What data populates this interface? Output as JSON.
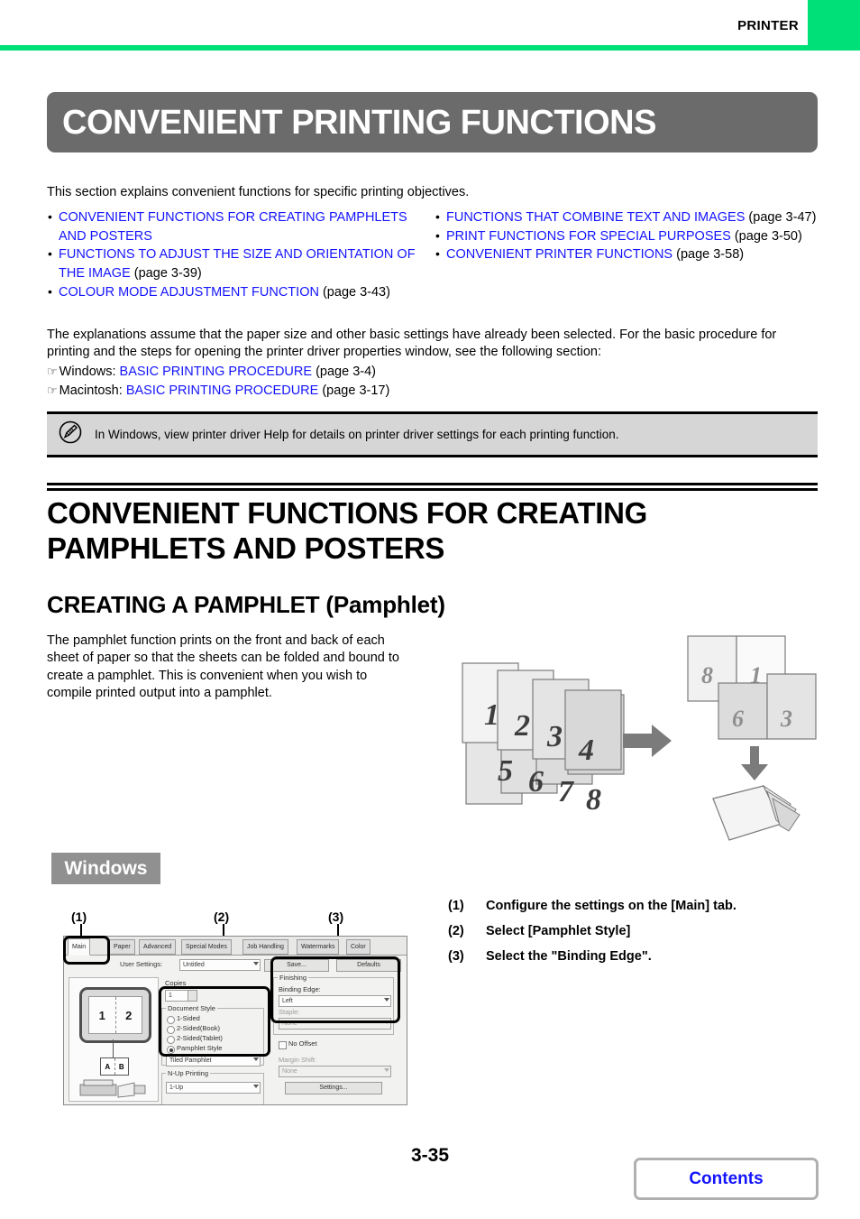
{
  "header": {
    "section_label": "PRINTER",
    "accent_color": "#00e078"
  },
  "page_title": "CONVENIENT PRINTING FUNCTIONS",
  "intro": "This section explains convenient functions for specific printing objectives.",
  "links": {
    "left": [
      {
        "text": "CONVENIENT FUNCTIONS FOR CREATING PAMPHLETS AND POSTERS",
        "page": ""
      },
      {
        "text": "FUNCTIONS TO ADJUST THE SIZE AND ORIENTATION OF THE IMAGE",
        "page": " (page 3-39)"
      },
      {
        "text": "COLOUR MODE ADJUSTMENT FUNCTION",
        "page": " (page 3-43)"
      }
    ],
    "right": [
      {
        "text": "FUNCTIONS THAT COMBINE TEXT AND IMAGES",
        "page": " (page 3-47)"
      },
      {
        "text": "PRINT FUNCTIONS FOR SPECIAL PURPOSES",
        "page": " (page 3-50)"
      },
      {
        "text": "CONVENIENT PRINTER FUNCTIONS",
        "page": " (page 3-58)"
      }
    ]
  },
  "explanation": "The explanations assume that the paper size and other basic settings have already been selected. For the basic procedure for printing and the steps for opening the printer driver properties window, see the following section:",
  "procedures": [
    {
      "os": "Windows: ",
      "link": "BASIC PRINTING PROCEDURE",
      "page": " (page 3-4)"
    },
    {
      "os": "Macintosh: ",
      "link": "BASIC PRINTING PROCEDURE",
      "page": " (page 3-17)"
    }
  ],
  "note": {
    "icon": "pencil-note-icon",
    "text": "In Windows, view printer driver Help for details on printer driver settings for each printing function."
  },
  "section_heading": "CONVENIENT FUNCTIONS FOR CREATING PAMPHLETS AND POSTERS",
  "sub_heading": "CREATING A PAMPHLET (Pamphlet)",
  "pamphlet_description": "The pamphlet function prints on the front and back of each sheet of paper so that the sheets can be folded and bound to create a pamphlet. This is convenient when you wish to compile printed output into a pamphlet.",
  "illustration": {
    "source_pages": [
      "1",
      "2",
      "3",
      "4",
      "5",
      "6",
      "7",
      "8"
    ],
    "result_sheet_front": [
      "8",
      "1"
    ],
    "result_sheet_back": [
      "6",
      "3"
    ],
    "arrow_right": "right-arrow-icon",
    "arrow_down": "down-arrow-icon"
  },
  "platform_badge": "Windows",
  "callouts": [
    "(1)",
    "(2)",
    "(3)"
  ],
  "instructions": [
    {
      "num": "(1)",
      "text": "Configure the settings on the [Main] tab."
    },
    {
      "num": "(2)",
      "text": "Select [Pamphlet Style]"
    },
    {
      "num": "(3)",
      "text": "Select the \"Binding Edge\"."
    }
  ],
  "dialog": {
    "tabs": [
      "Main",
      "Paper",
      "Advanced",
      "Special Modes",
      "Job Handling",
      "Watermarks",
      "Color"
    ],
    "active_tab": "Main",
    "user_settings_label": "User Settings:",
    "user_settings_value": "Untitled",
    "save_button": "Save...",
    "defaults_button": "Defaults",
    "copies_label": "Copies",
    "copies_value": "1",
    "preview_pages": [
      "1",
      "2"
    ],
    "preview_ab": [
      "A",
      "B"
    ],
    "document_style": {
      "title": "Document Style",
      "options": [
        "1-Sided",
        "2-Sided(Book)",
        "2-Sided(Tablet)",
        "Pamphlet Style"
      ],
      "selected": "Pamphlet Style",
      "dropdown_value": "Tiled Pamphlet"
    },
    "nup_printing": {
      "title": "N-Up Printing",
      "value": "1-Up"
    },
    "finishing": {
      "title": "Finishing",
      "binding_edge_label": "Binding Edge:",
      "binding_edge_value": "Left",
      "staple_label": "Staple:",
      "staple_value": "None",
      "no_offset_label": "No Offset",
      "margin_shift_label": "Margin Shift:",
      "margin_shift_value": "None",
      "settings_button": "Settings..."
    }
  },
  "footer": {
    "page_number": "3-35",
    "contents_button": "Contents"
  }
}
